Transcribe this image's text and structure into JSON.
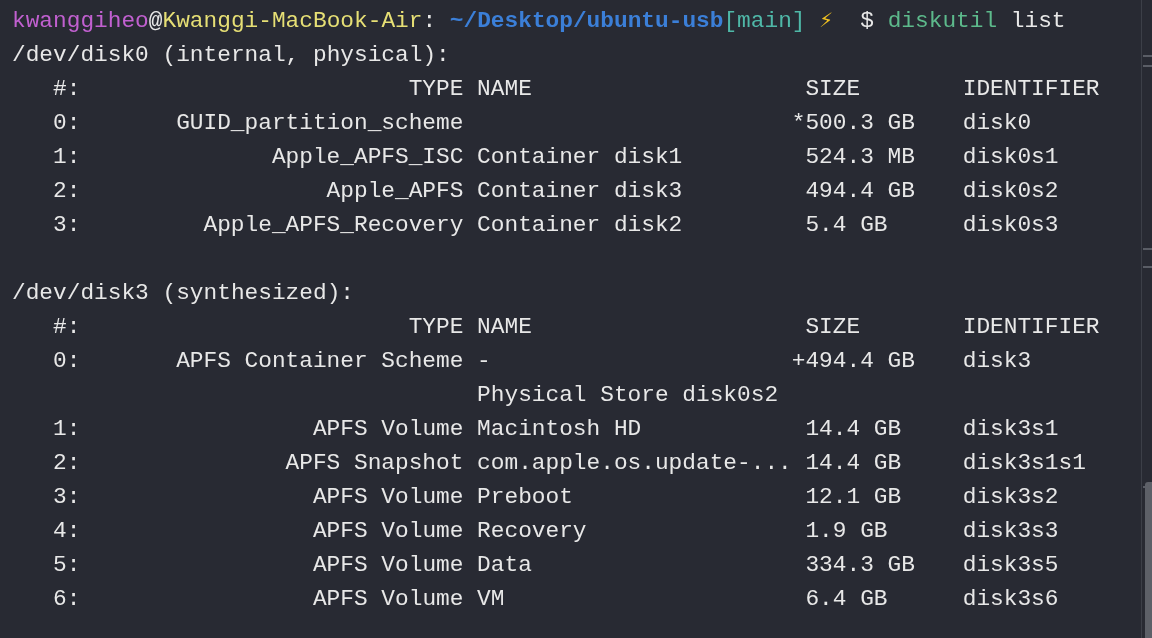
{
  "prompt": [
    {
      "kind": "user",
      "text": "kwanggiheo"
    },
    {
      "kind": "plain",
      "text": "@"
    },
    {
      "kind": "host",
      "text": "Kwanggi-MacBook-Air"
    },
    {
      "kind": "plain",
      "text": ":"
    },
    {
      "kind": "path",
      "text": "~/Desktop/ubuntu-usb"
    },
    {
      "kind": "branch",
      "text": "[main]"
    },
    {
      "kind": "icon",
      "text": "⚡"
    },
    {
      "kind": "plain",
      "text": "$"
    },
    {
      "kind": "command",
      "text": "diskutil"
    },
    {
      "kind": "plain",
      "text": "list"
    }
  ],
  "disks": [
    {
      "title": "/dev/disk0 (internal, physical):",
      "header": {
        "number": "#:",
        "type": "TYPE",
        "name": "NAME",
        "size": "SIZE",
        "identifier": "IDENTIFIER"
      },
      "rows": [
        {
          "number": "0:",
          "type": "GUID_partition_scheme",
          "size_mark": "*",
          "size": "500.3 GB",
          "identifier": "disk0"
        },
        {
          "number": "1:",
          "type": "Apple_APFS_ISC",
          "name": "Container disk1",
          "size": "524.3 MB",
          "identifier": "disk0s1"
        },
        {
          "number": "2:",
          "type": "Apple_APFS",
          "name": "Container disk3",
          "size": "494.4 GB",
          "identifier": "disk0s2"
        },
        {
          "number": "3:",
          "type": "Apple_APFS_Recovery",
          "name": "Container disk2",
          "size": "5.4 GB",
          "identifier": "disk0s3"
        }
      ]
    },
    {
      "title": "/dev/disk3 (synthesized):",
      "header": {
        "number": "#:",
        "type": "TYPE",
        "name": "NAME",
        "size": "SIZE",
        "identifier": "IDENTIFIER"
      },
      "rows": [
        {
          "number": "0:",
          "type": "APFS Container Scheme",
          "name": "-",
          "size_mark": "+",
          "size": "494.4 GB",
          "identifier": "disk3"
        },
        {
          "name": "Physical Store disk0s2"
        },
        {
          "number": "1:",
          "type": "APFS Volume",
          "name": "Macintosh HD",
          "size": "14.4 GB",
          "identifier": "disk3s1"
        },
        {
          "number": "2:",
          "type": "APFS Snapshot",
          "name": "com.apple.os.update-...",
          "size": "14.4 GB",
          "identifier": "disk3s1s1"
        },
        {
          "number": "3:",
          "type": "APFS Volume",
          "name": "Preboot",
          "size": "12.1 GB",
          "identifier": "disk3s2"
        },
        {
          "number": "4:",
          "type": "APFS Volume",
          "name": "Recovery",
          "size": "1.9 GB",
          "identifier": "disk3s3"
        },
        {
          "number": "5:",
          "type": "APFS Volume",
          "name": "Data",
          "size": "334.3 GB",
          "identifier": "disk3s5"
        },
        {
          "number": "6:",
          "type": "APFS Volume",
          "name": "VM",
          "size": "6.4 GB",
          "identifier": "disk3s6"
        }
      ]
    }
  ]
}
